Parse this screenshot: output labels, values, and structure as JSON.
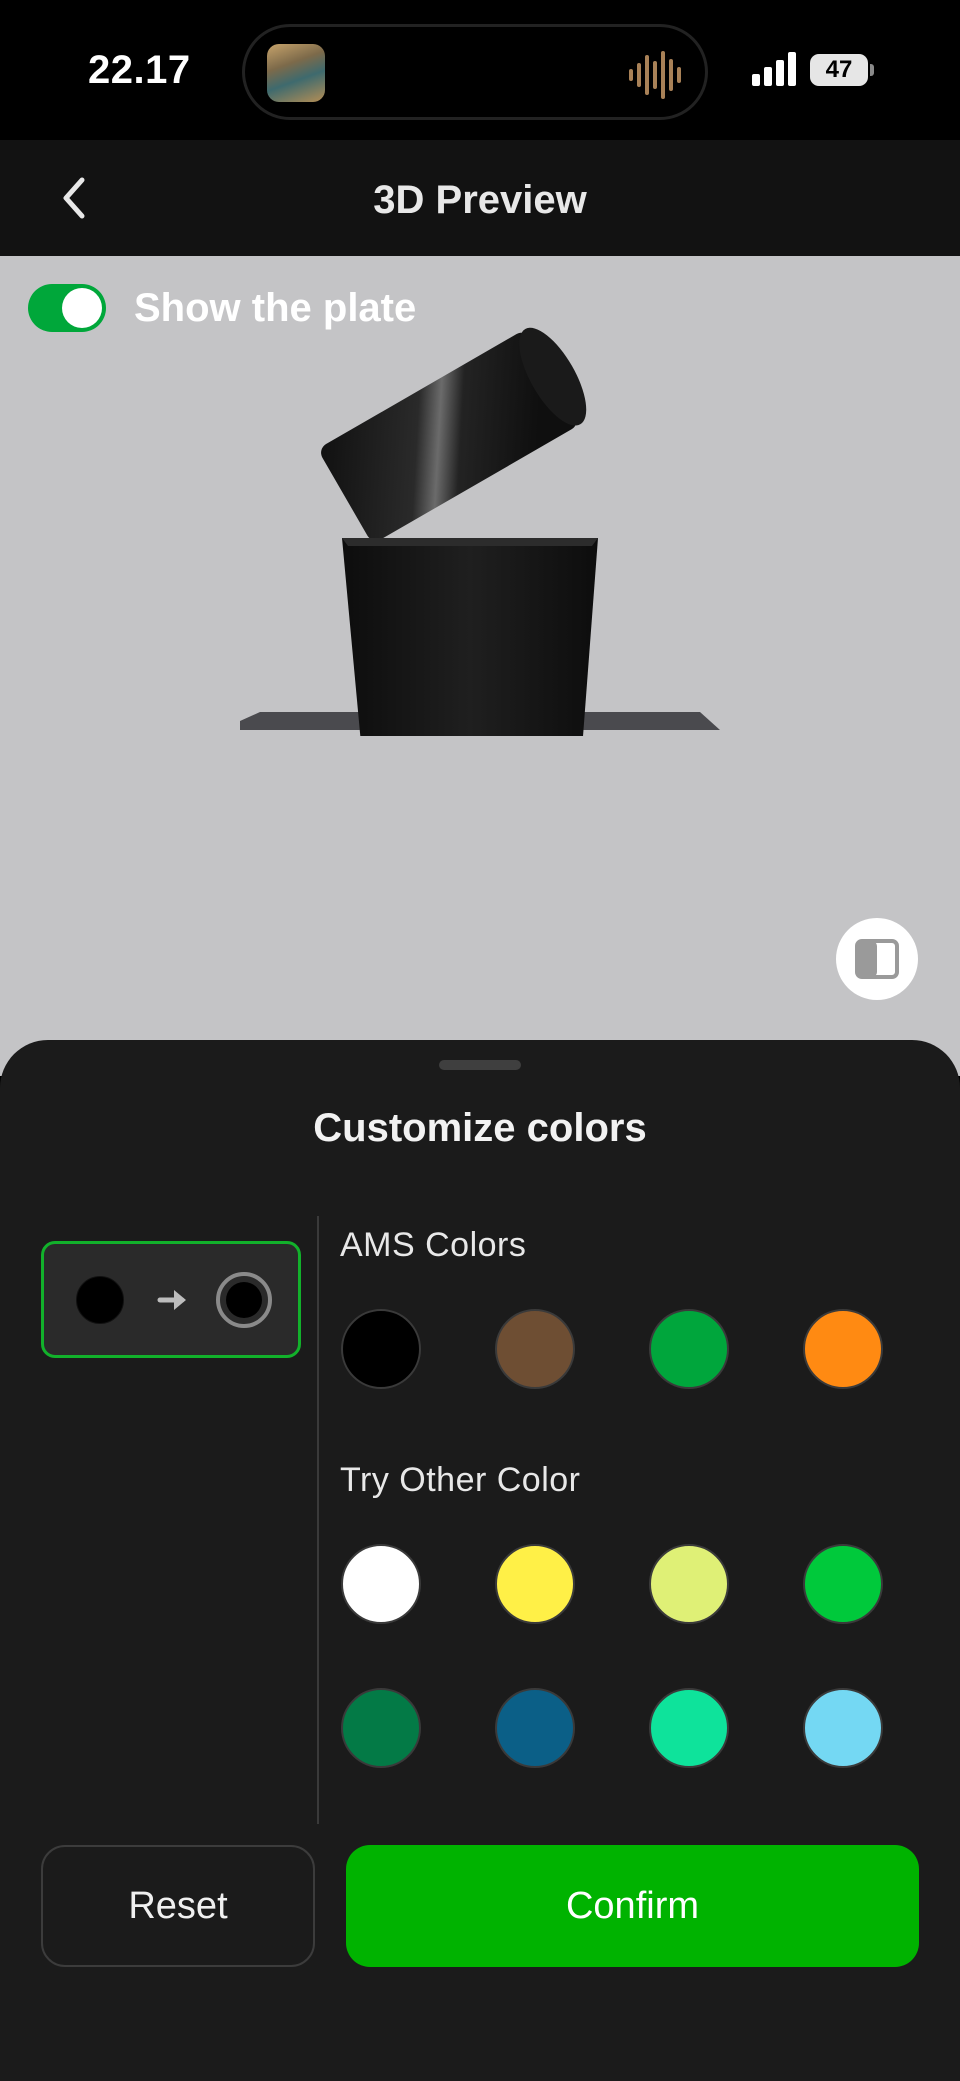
{
  "status_bar": {
    "time": "22.17",
    "battery": "47"
  },
  "nav": {
    "title": "3D Preview",
    "back_icon": "chevron-left-icon"
  },
  "viewport": {
    "toggle_on": true,
    "toggle_label": "Show the plate",
    "background_color": "#c4c4c6",
    "model_color": "#1a1a1a",
    "view_toggle_icon": "split-view-icon"
  },
  "sheet": {
    "title": "Customize colors",
    "mapping": {
      "from_color": "#000000",
      "to_color": "#000000",
      "arrow_icon": "arrow-right-icon"
    },
    "ams_label": "AMS Colors",
    "ams_colors": [
      "#000000",
      "#6e4e33",
      "#00a63c",
      "#ff8a12"
    ],
    "other_label": "Try Other Color",
    "other_colors": [
      "#ffffff",
      "#fff047",
      "#dff076",
      "#00c93b",
      "#037a46",
      "#0b5f87",
      "#0ee39b",
      "#74d8f3"
    ],
    "reset_label": "Reset",
    "confirm_label": "Confirm",
    "accent_color": "#00b300"
  }
}
